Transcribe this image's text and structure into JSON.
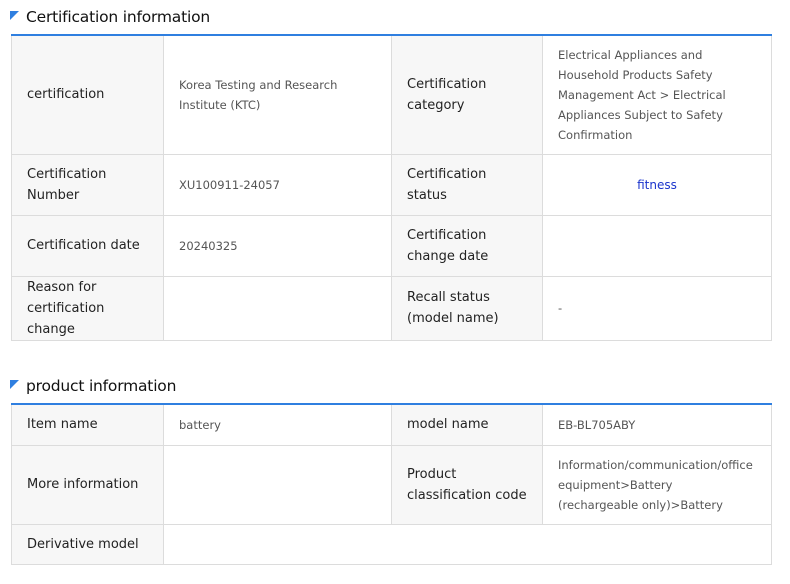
{
  "cert_section": {
    "title": "Certification information",
    "rows": [
      {
        "label1": "certification",
        "value1": "Korea Testing and Research Institute (KTC)",
        "label2": "Certification category",
        "value2": "Electrical Appliances and Household Products Safety Management Act > Electrical Appliances Subject to Safety Confirmation"
      },
      {
        "label1": "Certification Number",
        "value1": "XU100911-24057",
        "label2": "Certification status",
        "value2": "fitness"
      },
      {
        "label1": "Certification date",
        "value1": "20240325",
        "label2": "Certification change date",
        "value2": ""
      },
      {
        "label1": "Reason for certification change",
        "value1": "",
        "label2": "Recall status (model name)",
        "value2": "-"
      }
    ]
  },
  "product_section": {
    "title": "product information",
    "rows": [
      {
        "label1": "Item name",
        "value1": "battery",
        "label2": "model name",
        "value2": "EB-BL705ABY"
      },
      {
        "label1": "More information",
        "value1": "",
        "label2": "Product classification code",
        "value2": "Information/communication/office equipment>Battery (rechargeable only)>Battery"
      },
      {
        "label1": "Derivative model",
        "value1": ""
      }
    ]
  },
  "colors": {
    "accent": "#2f7fe0",
    "status_text": "#1a33cc",
    "label_bg": "#f7f7f7",
    "border": "#dcdcdc"
  },
  "icons": {
    "section_marker": "blue-corner-triangle-icon"
  }
}
